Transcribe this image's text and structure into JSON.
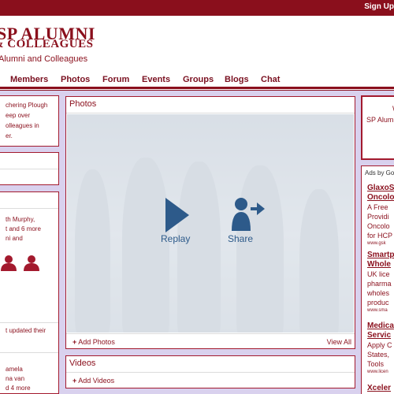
{
  "header": {
    "signup_label": "Sign Up",
    "logo_line1": "SP ALUMNI",
    "logo_line2": "& COLLEAGUES",
    "logo_tagline": "Alumni and Colleagues"
  },
  "nav": {
    "items": [
      "Members",
      "Photos",
      "Forum",
      "Events",
      "Groups",
      "Blogs",
      "Chat"
    ]
  },
  "left": {
    "welcome_lines": [
      "chering Plough",
      "eep over",
      "olleagues in",
      "er."
    ],
    "members_lines": [
      "th Murphy,",
      "t and 6 more",
      "ni and"
    ],
    "activity_line": "t updated their",
    "bottom_lines": [
      "amela",
      "na van",
      "d 4 more"
    ]
  },
  "photos": {
    "title": "Photos",
    "replay_label": "Replay",
    "share_label": "Share",
    "add_label": "Add Photos",
    "view_all_label": "View All"
  },
  "videos": {
    "title": "Videos",
    "add_label": "Add Videos"
  },
  "right": {
    "top_letter": "W",
    "top_text": "SP Alum",
    "ads_label": "Ads by Go",
    "ads": [
      {
        "title1": "GlaxoS",
        "title2": "Oncolo",
        "lines": [
          "A Free",
          "Providi",
          "Oncolo",
          "for HCP"
        ],
        "url": "www.gsk"
      },
      {
        "title1": "Smartp",
        "title2": "Whole",
        "lines": [
          "UK lice",
          "pharma",
          "wholes",
          "produc"
        ],
        "url": "www.sma"
      },
      {
        "title1": "Medica",
        "title2": "Servic",
        "lines": [
          "Apply C",
          "States,",
          "Tools"
        ],
        "url": "www.licen"
      },
      {
        "title1": "Xceler",
        "title2": "",
        "lines": [],
        "url": ""
      }
    ]
  },
  "colors": {
    "brand": "#8a0f1c",
    "background_panel": "#d9d1ee",
    "play_icon": "#2d5a8a"
  }
}
